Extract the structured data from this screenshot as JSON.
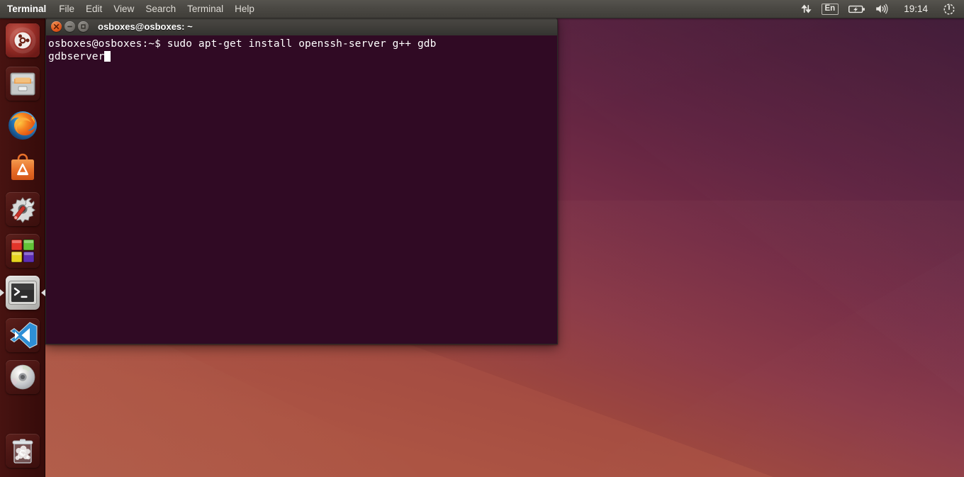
{
  "panel": {
    "app_name": "Terminal",
    "menus": [
      "File",
      "Edit",
      "View",
      "Search",
      "Terminal",
      "Help"
    ],
    "indicators": {
      "network_icon": "network-up-down-icon",
      "keyboard_layout": "En",
      "battery_icon": "battery-charging-icon",
      "volume_icon": "volume-icon",
      "clock": "19:14",
      "session_icon": "gear-power-icon"
    },
    "colors": {
      "panel_bg": "#4a4843",
      "panel_text": "#dedbd5"
    }
  },
  "launcher": {
    "items": [
      {
        "name": "dash-home",
        "label": "Ubuntu Dash Home",
        "icon": "ubuntu-logo-icon",
        "running": false
      },
      {
        "name": "files",
        "label": "Files",
        "icon": "file-cabinet-icon",
        "running": false
      },
      {
        "name": "firefox",
        "label": "Firefox Web Browser",
        "icon": "firefox-icon",
        "running": false
      },
      {
        "name": "software-center",
        "label": "Ubuntu Software Center",
        "icon": "software-bag-icon",
        "running": false
      },
      {
        "name": "system-settings",
        "label": "System Settings",
        "icon": "gear-wrench-icon",
        "running": false
      },
      {
        "name": "workspace-switcher",
        "label": "Workspace Switcher",
        "icon": "four-squares-icon",
        "running": false
      },
      {
        "name": "terminal",
        "label": "Terminal",
        "icon": "terminal-prompt-icon",
        "running": true
      },
      {
        "name": "vscode",
        "label": "Visual Studio Code",
        "icon": "vscode-ribbon-icon",
        "running": false
      },
      {
        "name": "disc",
        "label": "CD/DVD Drive",
        "icon": "optical-disc-icon",
        "running": false
      },
      {
        "name": "trash",
        "label": "Trash",
        "icon": "trash-bin-icon",
        "running": false
      }
    ],
    "colors": {
      "launcher_bg": "#3d0e0c"
    }
  },
  "terminal_window": {
    "title": "osboxes@osboxes: ~",
    "buttons": {
      "close": "close-icon",
      "minimize": "minimize-icon",
      "maximize": "maximize-icon"
    },
    "colors": {
      "bg": "#300a24",
      "text": "#ffffff",
      "titlebar": "#403e3a"
    },
    "lines": [
      "osboxes@osboxes:~$ sudo apt-get install openssh-server g++ gdb",
      "gdbserver"
    ],
    "prompt": "osboxes@osboxes:~$",
    "command": "sudo apt-get install openssh-server g++ gdb gdbserver",
    "cursor_visible": true
  },
  "desktop": {
    "wallpaper_name": "ubuntu-suru-gradient",
    "colors": {
      "top": "#371432",
      "bottom": "#b05a45"
    }
  }
}
